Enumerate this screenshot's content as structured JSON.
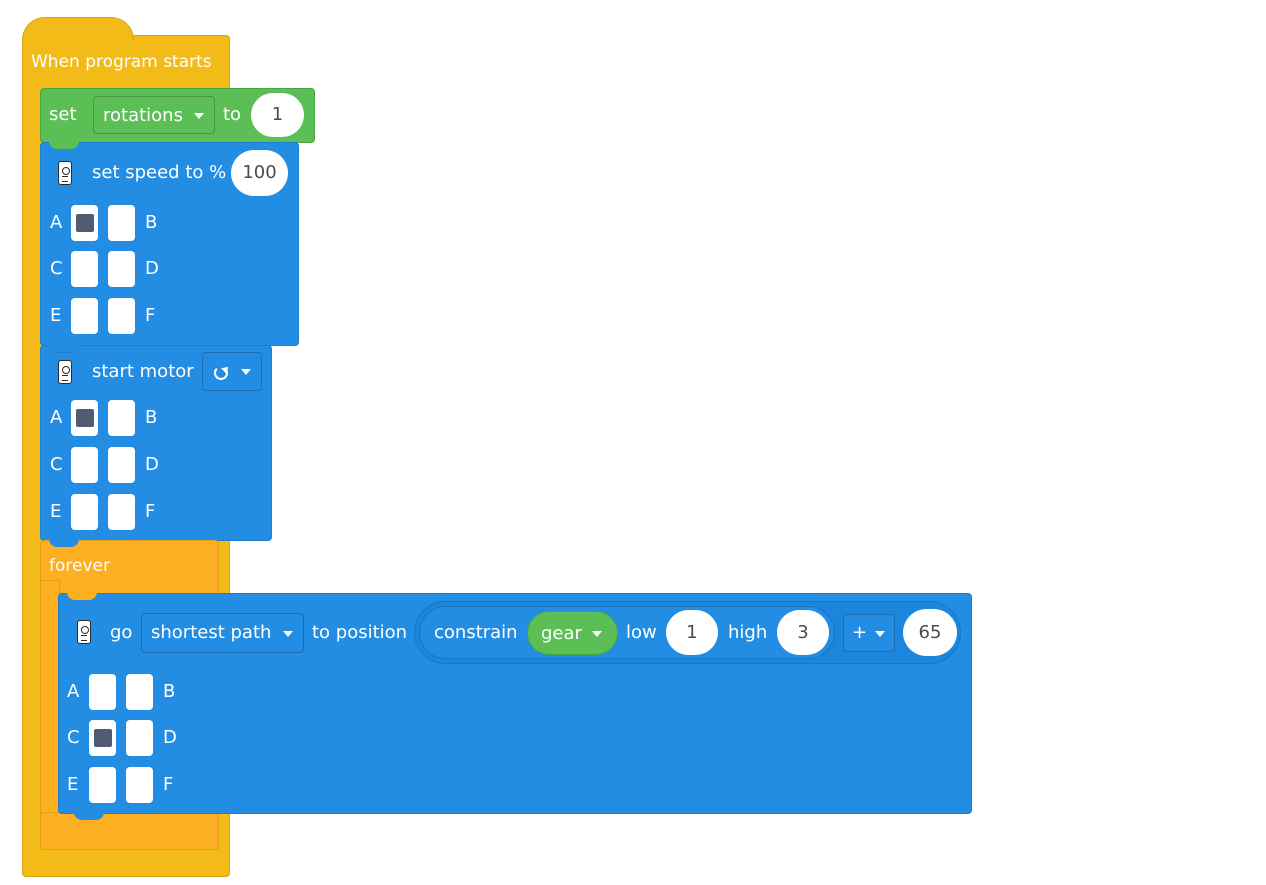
{
  "event_block": {
    "label": "When program starts"
  },
  "set_variable_block": {
    "label_set": "set",
    "variable": "rotations",
    "label_to": "to",
    "value": "1"
  },
  "set_speed_block": {
    "label": "set speed to %",
    "value": "100",
    "ports": {
      "A": "A",
      "B": "B",
      "C": "C",
      "D": "D",
      "E": "E",
      "F": "F"
    },
    "selected_ports": [
      "A"
    ]
  },
  "start_motor_block": {
    "label": "start motor",
    "direction_icon": "rotate-clockwise-icon",
    "ports": {
      "A": "A",
      "B": "B",
      "C": "C",
      "D": "D",
      "E": "E",
      "F": "F"
    },
    "selected_ports": [
      "A"
    ]
  },
  "forever_block": {
    "label": "forever"
  },
  "go_position_block": {
    "label_go": "go",
    "path": "shortest path",
    "label_to_position": "to position",
    "constrain": {
      "label": "constrain",
      "variable": "gear",
      "label_low": "low",
      "low": "1",
      "label_high": "high",
      "high": "3"
    },
    "operator": "+",
    "addend": "65",
    "ports": {
      "A": "A",
      "B": "B",
      "C": "C",
      "D": "D",
      "E": "E",
      "F": "F"
    },
    "selected_ports": [
      "C"
    ]
  },
  "colors": {
    "event": "#F3BB17",
    "variables": "#5CBF55",
    "motor": "#228DE3",
    "control": "#FDAE21"
  }
}
